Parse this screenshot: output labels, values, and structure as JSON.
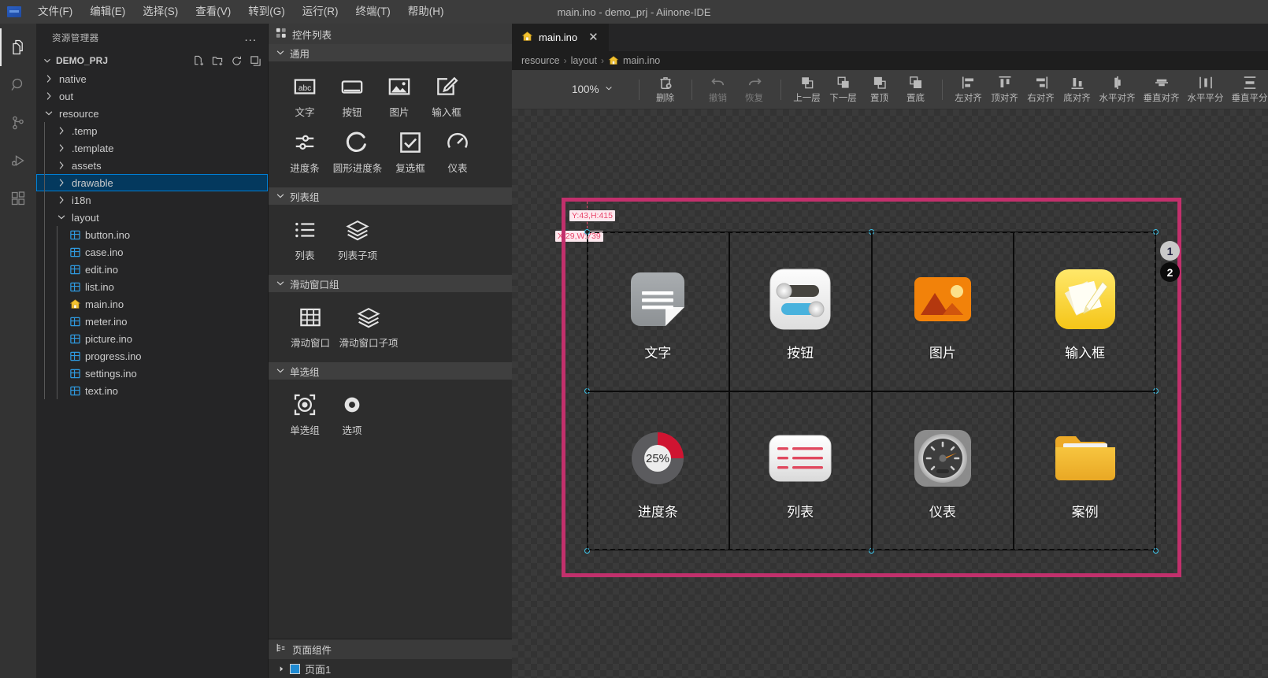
{
  "window": {
    "title": "main.ino - demo_prj - Aiinone-IDE",
    "logo_icon": "app-logo-icon"
  },
  "menubar": {
    "items": [
      {
        "label": "文件(F)",
        "name": "menu-file"
      },
      {
        "label": "编辑(E)",
        "name": "menu-edit"
      },
      {
        "label": "选择(S)",
        "name": "menu-select"
      },
      {
        "label": "查看(V)",
        "name": "menu-view"
      },
      {
        "label": "转到(G)",
        "name": "menu-goto"
      },
      {
        "label": "运行(R)",
        "name": "menu-run"
      },
      {
        "label": "终端(T)",
        "name": "menu-terminal"
      },
      {
        "label": "帮助(H)",
        "name": "menu-help"
      }
    ]
  },
  "activitybar": {
    "items": [
      {
        "icon": "files-explorer-icon",
        "active": true
      },
      {
        "icon": "search-icon",
        "active": false
      },
      {
        "icon": "source-control-icon",
        "active": false
      },
      {
        "icon": "run-and-debug-icon",
        "active": false
      },
      {
        "icon": "extensions-icon",
        "active": false
      }
    ]
  },
  "sidebar": {
    "header": "资源管理器",
    "more_actions": "...",
    "project": {
      "name": "DEMO_PRJ",
      "expanded": true,
      "actions": [
        "new-file-icon",
        "new-folder-icon",
        "refresh-icon",
        "collapse-all-icon"
      ]
    },
    "tree": [
      {
        "label": "native",
        "type": "folder",
        "depth": 1,
        "expanded": false,
        "selected": false
      },
      {
        "label": "out",
        "type": "folder",
        "depth": 1,
        "expanded": false,
        "selected": false
      },
      {
        "label": "resource",
        "type": "folder",
        "depth": 1,
        "expanded": true,
        "selected": false
      },
      {
        "label": ".temp",
        "type": "folder",
        "depth": 2,
        "expanded": false,
        "selected": false
      },
      {
        "label": ".template",
        "type": "folder",
        "depth": 2,
        "expanded": false,
        "selected": false
      },
      {
        "label": "assets",
        "type": "folder",
        "depth": 2,
        "expanded": false,
        "selected": false
      },
      {
        "label": "drawable",
        "type": "folder",
        "depth": 2,
        "expanded": false,
        "selected": true
      },
      {
        "label": "i18n",
        "type": "folder",
        "depth": 2,
        "expanded": false,
        "selected": false
      },
      {
        "label": "layout",
        "type": "folder",
        "depth": 2,
        "expanded": true,
        "selected": false
      },
      {
        "label": "button.ino",
        "type": "ino",
        "depth": 3,
        "selected": false
      },
      {
        "label": "case.ino",
        "type": "ino",
        "depth": 3,
        "selected": false
      },
      {
        "label": "edit.ino",
        "type": "ino",
        "depth": 3,
        "selected": false
      },
      {
        "label": "list.ino",
        "type": "ino",
        "depth": 3,
        "selected": false
      },
      {
        "label": "main.ino",
        "type": "home",
        "depth": 3,
        "selected": false
      },
      {
        "label": "meter.ino",
        "type": "ino",
        "depth": 3,
        "selected": false
      },
      {
        "label": "picture.ino",
        "type": "ino",
        "depth": 3,
        "selected": false
      },
      {
        "label": "progress.ino",
        "type": "ino",
        "depth": 3,
        "selected": false
      },
      {
        "label": "settings.ino",
        "type": "ino",
        "depth": 3,
        "selected": false
      },
      {
        "label": "text.ino",
        "type": "ino",
        "depth": 3,
        "selected": false
      }
    ]
  },
  "palette": {
    "title": "控件列表",
    "title_icon": "widgets-grid-icon",
    "groups": [
      {
        "name": "通用",
        "expanded": true,
        "items": [
          {
            "label": "文字",
            "icon": "abc-text-icon"
          },
          {
            "label": "按钮",
            "icon": "button-icon"
          },
          {
            "label": "图片",
            "icon": "image-icon"
          },
          {
            "label": "输入框",
            "icon": "edit-box-icon"
          },
          {
            "label": "进度条",
            "icon": "slider-icon"
          },
          {
            "label": "圆形进度条",
            "icon": "circular-progress-icon",
            "wide": true
          },
          {
            "label": "复选框",
            "icon": "checkbox-icon"
          },
          {
            "label": "仪表",
            "icon": "meter-gauge-icon"
          }
        ]
      },
      {
        "name": "列表组",
        "expanded": true,
        "items": [
          {
            "label": "列表",
            "icon": "list-icon"
          },
          {
            "label": "列表子项",
            "icon": "layers-icon",
            "wide": true
          }
        ]
      },
      {
        "name": "滑动窗口组",
        "expanded": true,
        "items": [
          {
            "label": "滑动窗口",
            "icon": "table-grid-icon",
            "wide": true
          },
          {
            "label": "滑动窗口子项",
            "icon": "layers-icon",
            "wide": true
          }
        ]
      },
      {
        "name": "单选组",
        "expanded": true,
        "items": [
          {
            "label": "单选组",
            "icon": "radio-group-icon"
          },
          {
            "label": "选项",
            "icon": "radio-option-icon"
          }
        ]
      }
    ],
    "page_components": {
      "title": "页面组件",
      "title_icon": "tree-outline-icon",
      "nodes": [
        {
          "label": "页面1",
          "icon": "page-square-icon",
          "expanded": false
        }
      ]
    }
  },
  "editor": {
    "tabs": [
      {
        "label": "main.ino",
        "icon": "home-file-icon",
        "active": true,
        "close_icon": "close-icon"
      }
    ],
    "breadcrumb": [
      "resource",
      "layout",
      "main.ino"
    ],
    "breadcrumb_leaf_icon": "home-file-icon",
    "separator": "›"
  },
  "toolbar": {
    "zoom": {
      "value": "100%",
      "chevron": "chevron-down-icon"
    },
    "buttons": [
      {
        "label": "删除",
        "icon": "delete-icon",
        "disabled": false,
        "sep_after": true
      },
      {
        "label": "撤销",
        "icon": "undo-icon",
        "disabled": true
      },
      {
        "label": "恢复",
        "icon": "redo-icon",
        "disabled": true,
        "sep_after": true
      },
      {
        "label": "上一层",
        "icon": "bring-forward-icon",
        "disabled": false
      },
      {
        "label": "下一层",
        "icon": "send-backward-icon",
        "disabled": false
      },
      {
        "label": "置顶",
        "icon": "bring-to-front-icon",
        "disabled": false
      },
      {
        "label": "置底",
        "icon": "send-to-back-icon",
        "disabled": false,
        "sep_after": true
      },
      {
        "label": "左对齐",
        "icon": "align-left-icon",
        "disabled": false
      },
      {
        "label": "顶对齐",
        "icon": "align-top-icon",
        "disabled": false
      },
      {
        "label": "右对齐",
        "icon": "align-right-icon",
        "disabled": false
      },
      {
        "label": "底对齐",
        "icon": "align-bottom-icon",
        "disabled": false
      },
      {
        "label": "水平对齐",
        "icon": "align-center-horizontal-icon",
        "disabled": false
      },
      {
        "label": "垂直对齐",
        "icon": "align-center-vertical-icon",
        "disabled": false
      },
      {
        "label": "水平平分",
        "icon": "distribute-horizontal-icon",
        "disabled": false
      },
      {
        "label": "垂直平分",
        "icon": "distribute-vertical-icon",
        "disabled": false
      }
    ]
  },
  "canvas": {
    "selection": {
      "border_color": "#c2306c",
      "measure_vertical": "Y:43,H:415",
      "measure_horizontal": "X:29,W:739"
    },
    "badges": [
      {
        "label": "1",
        "style": "light"
      },
      {
        "label": "2",
        "style": "dark"
      }
    ],
    "cells": [
      {
        "label": "文字",
        "icon": "doc-lines-icon"
      },
      {
        "label": "按钮",
        "icon": "toggle-switches-icon"
      },
      {
        "label": "图片",
        "icon": "photo-mountain-icon"
      },
      {
        "label": "输入框",
        "icon": "notes-pen-icon"
      },
      {
        "label": "进度条",
        "icon": "donut-progress-icon",
        "value": "25%"
      },
      {
        "label": "列表",
        "icon": "list-card-icon"
      },
      {
        "label": "仪表",
        "icon": "gauge-dial-icon"
      },
      {
        "label": "案例",
        "icon": "folder-icon"
      }
    ]
  }
}
